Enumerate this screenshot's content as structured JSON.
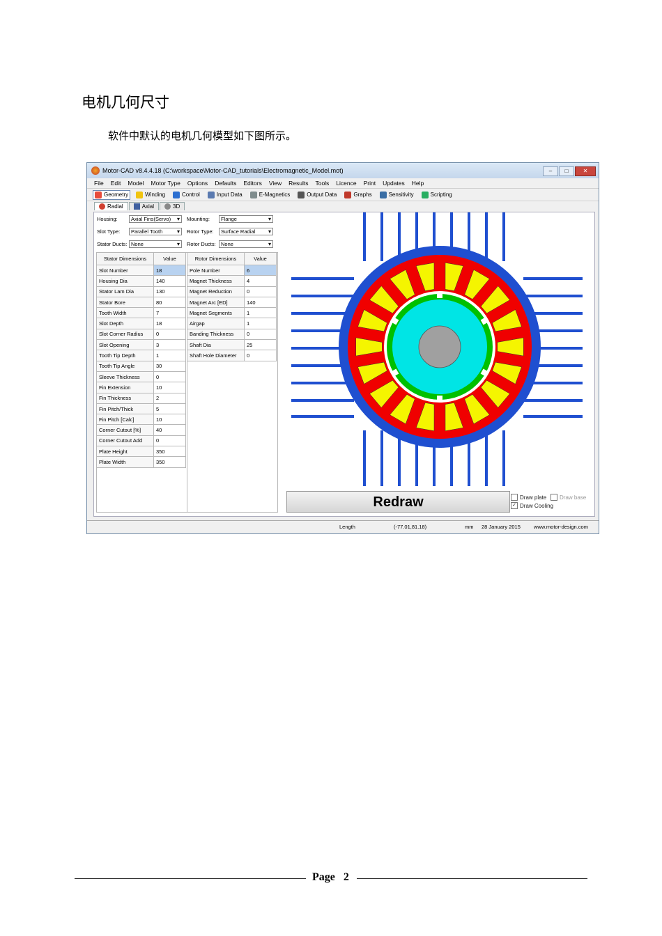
{
  "heading": "电机几何尺寸",
  "paragraph": "软件中默认的电机几何模型如下图所示。",
  "window": {
    "title": "Motor-CAD v8.4.4.18 (C:\\workspace\\Motor-CAD_tutorials\\Electromagnetic_Model.mot)",
    "buttons": [
      "–",
      "□",
      "✕"
    ],
    "menu": [
      "File",
      "Edit",
      "Model",
      "Motor Type",
      "Options",
      "Defaults",
      "Editors",
      "View",
      "Results",
      "Tools",
      "Licence",
      "Print",
      "Updates",
      "Help"
    ],
    "toolbar": [
      {
        "label": "Geometry",
        "icon": "geometry-icon",
        "color": "#e74c3c"
      },
      {
        "label": "Winding",
        "icon": "winding-icon",
        "color": "#f1c40f"
      },
      {
        "label": "Control",
        "icon": "control-icon",
        "color": "#2c6fd1"
      },
      {
        "label": "Input Data",
        "icon": "input-data-icon",
        "color": "#5a7ab0"
      },
      {
        "label": "E-Magnetics",
        "icon": "emagnetics-icon",
        "color": "#7f8c8d"
      },
      {
        "label": "Output Data",
        "icon": "output-data-icon",
        "color": "#555555"
      },
      {
        "label": "Graphs",
        "icon": "graphs-icon",
        "color": "#c0392b"
      },
      {
        "label": "Sensitivity",
        "icon": "sensitivity-icon",
        "color": "#3a6ea5"
      },
      {
        "label": "Scripting",
        "icon": "scripting-icon",
        "color": "#27ae60"
      }
    ],
    "subtabs": [
      "Radial",
      "Axial",
      "3D"
    ],
    "controls": {
      "housing_label": "Housing:",
      "housing_value": "Axial Fins(Servo)",
      "mounting_label": "Mounting:",
      "mounting_value": "Flange",
      "slot_type_label": "Slot Type:",
      "slot_type_value": "Parallel Tooth",
      "rotor_type_label": "Rotor Type:",
      "rotor_type_value": "Surface Radial",
      "stator_ducts_label": "Stator Ducts:",
      "stator_ducts_value": "None",
      "rotor_ducts_label": "Rotor Ducts:",
      "rotor_ducts_value": "None"
    },
    "stator_table": {
      "headers": [
        "Stator Dimensions",
        "Value"
      ],
      "rows": [
        [
          "Slot Number",
          "18"
        ],
        [
          "Housing Dia",
          "140"
        ],
        [
          "Stator Lam Dia",
          "130"
        ],
        [
          "Stator Bore",
          "80"
        ],
        [
          "Tooth Width",
          "7"
        ],
        [
          "Slot Depth",
          "18"
        ],
        [
          "Slot Corner Radius",
          "0"
        ],
        [
          "Slot Opening",
          "3"
        ],
        [
          "Tooth Tip Depth",
          "1"
        ],
        [
          "Tooth Tip Angle",
          "30"
        ],
        [
          "Sleeve Thickness",
          "0"
        ],
        [
          "Fin Extension",
          "10"
        ],
        [
          "Fin Thickness",
          "2"
        ],
        [
          "Fin Pitch/Thick",
          "5"
        ],
        [
          "Fin Pitch [Calc]",
          "10"
        ],
        [
          "Corner Cutout [%]",
          "40"
        ],
        [
          "Corner Cutout Add",
          "0"
        ],
        [
          "Plate Height",
          "350"
        ],
        [
          "Plate Width",
          "350"
        ]
      ]
    },
    "rotor_table": {
      "headers": [
        "Rotor Dimensions",
        "Value"
      ],
      "rows": [
        [
          "Pole Number",
          "6"
        ],
        [
          "Magnet Thickness",
          "4"
        ],
        [
          "Magnet Reduction",
          "0"
        ],
        [
          "Magnet Arc [ED]",
          "140"
        ],
        [
          "Magnet Segments",
          "1"
        ],
        [
          "Airgap",
          "1"
        ],
        [
          "Banding Thickness",
          "0"
        ],
        [
          "Shaft Dia",
          "25"
        ],
        [
          "Shaft Hole Diameter",
          "0"
        ]
      ]
    },
    "redraw_label": "Redraw",
    "checkboxes": {
      "draw_plate": "Draw plate",
      "draw_base": "Draw base",
      "draw_cooling": "Draw Cooling"
    },
    "status": {
      "length_label": "Length",
      "coords": "(-77.01,81.18)",
      "unit": "mm",
      "date": "28 January 2015",
      "website": "www.motor-design.com"
    },
    "colors": {
      "housing": "#1f4fd0",
      "stator": "#f00000",
      "winding": "#f5f500",
      "rotor": "#00c000",
      "airgap_core": "#00e5e5",
      "shaft": "#a0a0a0"
    }
  },
  "footer": {
    "page_label": "Page",
    "page_number": "2"
  }
}
